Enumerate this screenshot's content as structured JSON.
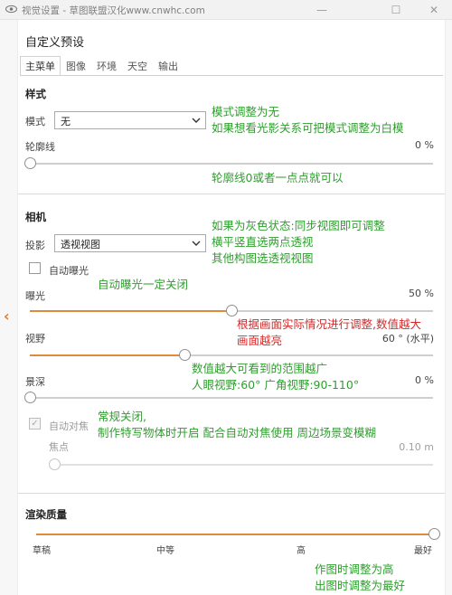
{
  "window": {
    "title": "视觉设置 - 草图联盟汉化www.cnwhc.com",
    "min_glyph": "—",
    "max_glyph": "☐",
    "close_glyph": "✕",
    "collapse_glyph": "‹"
  },
  "panel": {
    "title": "自定义预设"
  },
  "tabs": [
    {
      "label": "主菜单",
      "active": true
    },
    {
      "label": "图像"
    },
    {
      "label": "环境"
    },
    {
      "label": "天空"
    },
    {
      "label": "输出"
    }
  ],
  "style_section": {
    "heading": "样式",
    "mode_label": "模式",
    "mode_value": "无",
    "outline_label": "轮廓线",
    "outline_value": "0 %",
    "outline_fraction": 0.0
  },
  "camera_section": {
    "heading": "相机",
    "projection_label": "投影",
    "projection_value": "透视视图",
    "auto_exposure_label": "自动曝光",
    "auto_exposure_checked": false,
    "exposure_label": "曝光",
    "exposure_value": "50 %",
    "exposure_fraction": 0.5,
    "fov_label": "视野",
    "fov_value": "60 ° (水平)",
    "fov_fraction": 0.385,
    "dof_label": "景深",
    "dof_value": "0 %",
    "dof_fraction": 0.0,
    "autofocus_label": "自动对焦",
    "autofocus_checked": true,
    "focus_label": "焦点",
    "focus_value": "0.10 m",
    "focus_fraction": 0.0
  },
  "render_section": {
    "heading": "渲染质量",
    "quality_fraction": 1.0,
    "levels": [
      "草稿",
      "中等",
      "高",
      "最好"
    ]
  },
  "annotations": {
    "mode_note": [
      "模式调整为无",
      "如果想看光影关系可把模式调整为白模"
    ],
    "outline_note": "轮廓线0或者一点点就可以",
    "projection_note": [
      "如果为灰色状态:同步视图即可调整",
      "横平竖直选两点透视",
      "其他构图选透视视图"
    ],
    "exposure_note": "自动曝光一定关闭",
    "exposure_red_note": [
      "根据画面实际情况进行调整,数值越大",
      "画面越亮"
    ],
    "fov_note": [
      "数值越大可看到的范围越广",
      "人眼视野:60° 广角视野:90-110°"
    ],
    "dof_note": [
      "常规关闭,",
      "制作特写物体时开启 配合自动对焦使用 周边场景变模糊"
    ],
    "quality_note": [
      "作图时调整为高",
      "出图时调整为最好"
    ]
  },
  "colors": {
    "accent": "#e08a3c",
    "note_green": "#2e9e2e",
    "note_red": "#d42a2a"
  }
}
